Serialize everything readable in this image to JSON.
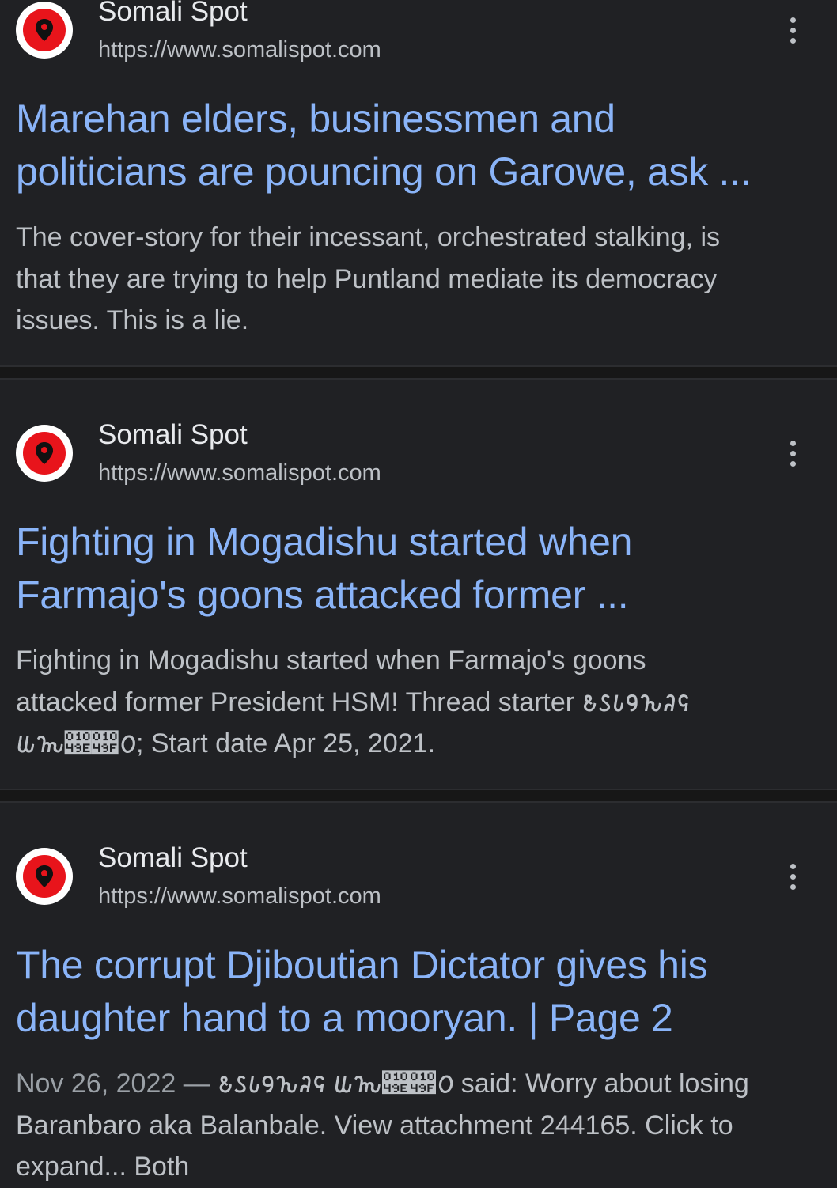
{
  "results": [
    {
      "site_name": "Somali Spot",
      "url": "https://www.somalispot.com",
      "title_lines": [
        "Marehan elders, businessmen and",
        "politicians are pouncing on Garowe, ask ..."
      ],
      "snippet_lines": [
        "The cover-story for their incessant, orchestrated stalking, is",
        "that they are trying to help Puntland mediate its democracy",
        "issues. This is a lie."
      ],
      "favicon_icon": "map-pin-icon",
      "menu_icon": "more-vert-icon"
    },
    {
      "site_name": "Somali Spot",
      "url": "https://www.somalispot.com",
      "title_lines": [
        "Fighting in Mogadishu started when",
        "Farmajo's goons attacked former ..."
      ],
      "snippet_lines": [
        "Fighting in Mogadishu started when Farmajo's goons",
        "attacked former President HSM! Thread starter 𐒕𐒖𐒗𐒘𐒙𐒚𐒛",
        "𐒜𐒝𐒞𐒟𐒠; Start date Apr 25, 2021."
      ],
      "favicon_icon": "map-pin-icon",
      "menu_icon": "more-vert-icon"
    },
    {
      "site_name": "Somali Spot",
      "url": "https://www.somalispot.com",
      "title_lines": [
        "The corrupt Djiboutian Dictator gives his",
        "daughter hand to a mooryan. | Page 2"
      ],
      "snippet_date": "Nov 26, 2022 — ",
      "snippet_lines": [
        "𐒕𐒖𐒗𐒘𐒙𐒚𐒛 𐒜𐒝𐒞𐒟𐒠 said: Worry about losing",
        "Baranbaro aka Balanbale. View attachment 244165. Click to",
        "expand... Both"
      ],
      "favicon_icon": "map-pin-icon",
      "menu_icon": "more-vert-icon"
    }
  ],
  "colors": {
    "background": "#202124",
    "title_link": "#8ab4f8",
    "text": "#bdc1c6",
    "site_name": "#e8eaed",
    "favicon_red": "#e8141b"
  }
}
